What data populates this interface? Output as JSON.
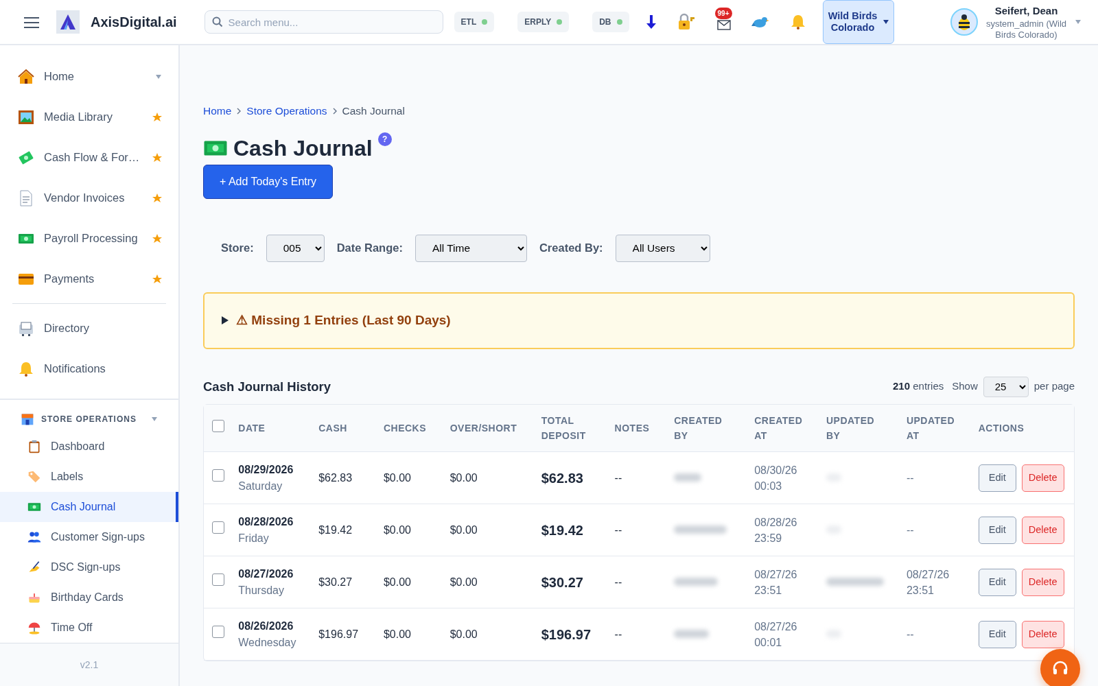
{
  "header": {
    "brand": "AxisDigital.ai",
    "search_placeholder": "Search menu...",
    "status_pills": [
      {
        "label": "ETL",
        "color": "#7fcf8f"
      },
      {
        "label": "ERPLY",
        "color": "#7fcf8f"
      },
      {
        "label": "DB",
        "color": "#7fcf8f"
      }
    ],
    "mail_badge": "99+",
    "store_button": "Wild Birds Colorado",
    "user": {
      "name": "Seifert, Dean",
      "role": "system_admin (Wild Birds Colorado)"
    }
  },
  "sidebar": {
    "items": [
      {
        "label": "Home",
        "kind": "menu"
      },
      {
        "label": "Media Library",
        "kind": "starred"
      },
      {
        "label": "Cash Flow & For…",
        "kind": "starred"
      },
      {
        "label": "Vendor Invoices",
        "kind": "starred"
      },
      {
        "label": "Payroll Processing",
        "kind": "starred"
      },
      {
        "label": "Payments",
        "kind": "starred"
      },
      {
        "label": "Directory",
        "kind": "plain"
      },
      {
        "label": "Notifications",
        "kind": "plain"
      }
    ],
    "section": {
      "label": "STORE OPERATIONS",
      "expanded": true,
      "items": [
        {
          "label": "Dashboard",
          "selected": false
        },
        {
          "label": "Labels",
          "selected": false
        },
        {
          "label": "Cash Journal",
          "selected": true
        },
        {
          "label": "Customer Sign-ups",
          "selected": false
        },
        {
          "label": "DSC Sign-ups",
          "selected": false
        },
        {
          "label": "Birthday Cards",
          "selected": false
        },
        {
          "label": "Time Off",
          "selected": false
        }
      ]
    },
    "version": "v2.1"
  },
  "breadcrumbs": [
    {
      "label": "Home",
      "link": true
    },
    {
      "label": "Store Operations",
      "link": true
    },
    {
      "label": "Cash Journal",
      "link": false
    }
  ],
  "title": "Cash Journal",
  "help": "?",
  "add_button": "+ Add Today's Entry",
  "filters": [
    {
      "label": "Store:",
      "value": "005"
    },
    {
      "label": "Date Range:",
      "value": "All Time"
    },
    {
      "label": "Created By:",
      "value": "All Users"
    }
  ],
  "alert": {
    "text": "⚠ Missing 1 Entries (Last 90 Days)",
    "expanded": false
  },
  "history": {
    "title": "Cash Journal History",
    "count": "210",
    "count_label": "entries",
    "show_label": "Show",
    "per_page": "25",
    "per_page_label": "per page",
    "columns": [
      "DATE",
      "CASH",
      "CHECKS",
      "OVER/SHORT",
      "TOTAL DEPOSIT",
      "NOTES",
      "CREATED BY",
      "CREATED AT",
      "UPDATED BY",
      "UPDATED AT",
      "ACTIONS"
    ],
    "select_all_checked": false,
    "rows": [
      {
        "date": "08/29/2026",
        "weekday": "Saturday",
        "cash": "$62.83",
        "checks": "$0.00",
        "over_short": "$0.00",
        "total": "$62.83",
        "notes": "--",
        "created_at": [
          "08/30/26",
          "00:03"
        ],
        "updated_by_shown": false,
        "updated_at": [
          "--"
        ],
        "checked": false,
        "edit": "Edit",
        "delete": "Delete"
      },
      {
        "date": "08/28/2026",
        "weekday": "Friday",
        "cash": "$19.42",
        "checks": "$0.00",
        "over_short": "$0.00",
        "total": "$19.42",
        "notes": "--",
        "created_at": [
          "08/28/26",
          "23:59"
        ],
        "updated_by_shown": false,
        "updated_at": [
          "--"
        ],
        "checked": false,
        "edit": "Edit",
        "delete": "Delete"
      },
      {
        "date": "08/27/2026",
        "weekday": "Thursday",
        "cash": "$30.27",
        "checks": "$0.00",
        "over_short": "$0.00",
        "total": "$30.27",
        "notes": "--",
        "created_at": [
          "08/27/26",
          "23:51"
        ],
        "updated_by_shown": true,
        "updated_at": [
          "08/27/26",
          "23:51"
        ],
        "checked": false,
        "edit": "Edit",
        "delete": "Delete"
      },
      {
        "date": "08/26/2026",
        "weekday": "Wednesday",
        "cash": "$196.97",
        "checks": "$0.00",
        "over_short": "$0.00",
        "total": "$196.97",
        "notes": "--",
        "created_at": [
          "08/27/26",
          "00:01"
        ],
        "updated_by_shown": false,
        "updated_at": [
          "--"
        ],
        "checked": false,
        "edit": "Edit",
        "delete": "Delete"
      }
    ]
  }
}
